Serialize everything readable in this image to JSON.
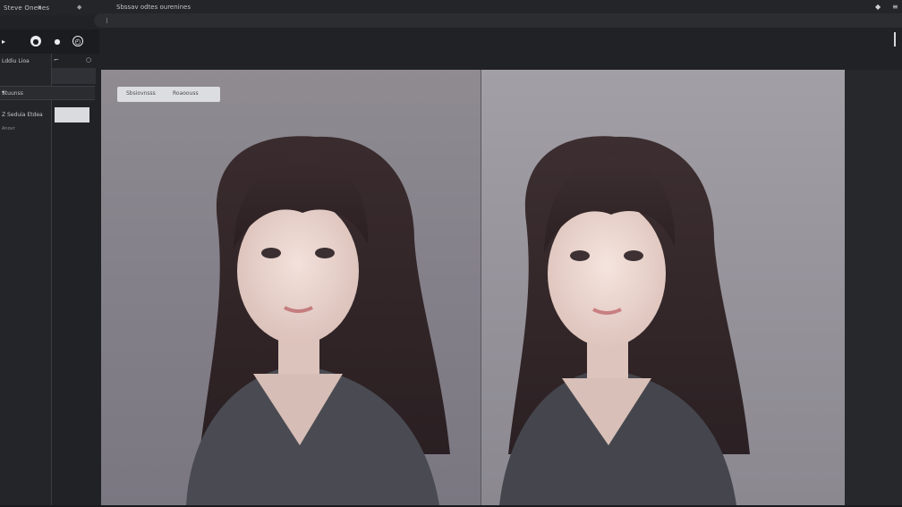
{
  "app": {
    "title_left": "Steve Onenes",
    "title_center": "Sbssav odtes ourenines"
  },
  "toolbar": {
    "tools": [
      "brush",
      "circle-tool",
      "pen-tool",
      "dial-tool"
    ]
  },
  "sidebar": {
    "section_label": "Lddiu Lioa",
    "select_label": "Stuunss",
    "item_label": "Z Seduia Etdea",
    "note_label": "Anovr"
  },
  "canvas": {
    "overlay_label_a": "Sbsiovnsss",
    "overlay_label_b": "Roaoouss"
  },
  "colors": {
    "background": "#202225",
    "panel": "#232528",
    "canvas_left": "#8f8b91",
    "canvas_right": "#a29fa6"
  }
}
